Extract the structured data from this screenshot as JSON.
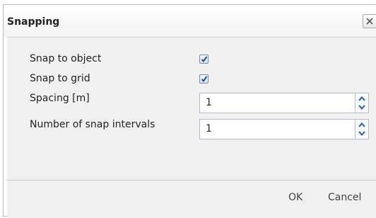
{
  "dialog": {
    "title": "Snapping",
    "close_icon": "close-icon"
  },
  "form": {
    "snap_to_object": {
      "label": "Snap to object",
      "checked": true
    },
    "snap_to_grid": {
      "label": "Snap to grid",
      "checked": true
    },
    "spacing": {
      "label": "Spacing [m]",
      "value": "1"
    },
    "snap_intervals": {
      "label": "Number of snap intervals",
      "value": "1"
    }
  },
  "buttons": {
    "ok": "OK",
    "cancel": "Cancel"
  }
}
